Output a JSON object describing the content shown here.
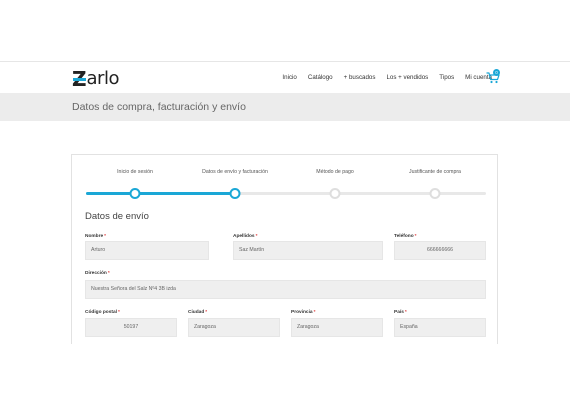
{
  "header": {
    "logo_letter": "Z",
    "logo_rest": "arlo",
    "nav": [
      "Inicio",
      "Catálogo",
      "+ buscados",
      "Los + vendidos",
      "Tipos",
      "Mi cuenta"
    ],
    "cart_count": "0",
    "accent_color": "#1aa7d6"
  },
  "title_bar": {
    "title": "Datos de compra, facturación y envío"
  },
  "steps": [
    {
      "label": "Inicio de sesión",
      "state": "done"
    },
    {
      "label": "Datos de envío y facturación",
      "state": "current"
    },
    {
      "label": "Método de pago",
      "state": "pending"
    },
    {
      "label": "Justificante de compra",
      "state": "pending"
    }
  ],
  "form": {
    "section_title": "Datos de envío",
    "required_mark": "*",
    "fields": {
      "nombre": {
        "label": "Nombre",
        "value": "Arturo"
      },
      "apellidos": {
        "label": "Apellidos",
        "value": "Saz Martín"
      },
      "telefono": {
        "label": "Teléfono",
        "value": "666666666"
      },
      "direccion": {
        "label": "Dirección",
        "value": "Nuestra Señora del Salz Nº4 3B izda"
      },
      "codigo_postal": {
        "label": "Código postal",
        "value": "50197"
      },
      "ciudad": {
        "label": "Ciudad",
        "value": "Zaragoza"
      },
      "provincia": {
        "label": "Provincia",
        "value": "Zaragoza"
      },
      "pais": {
        "label": "País",
        "value": "España"
      }
    }
  }
}
